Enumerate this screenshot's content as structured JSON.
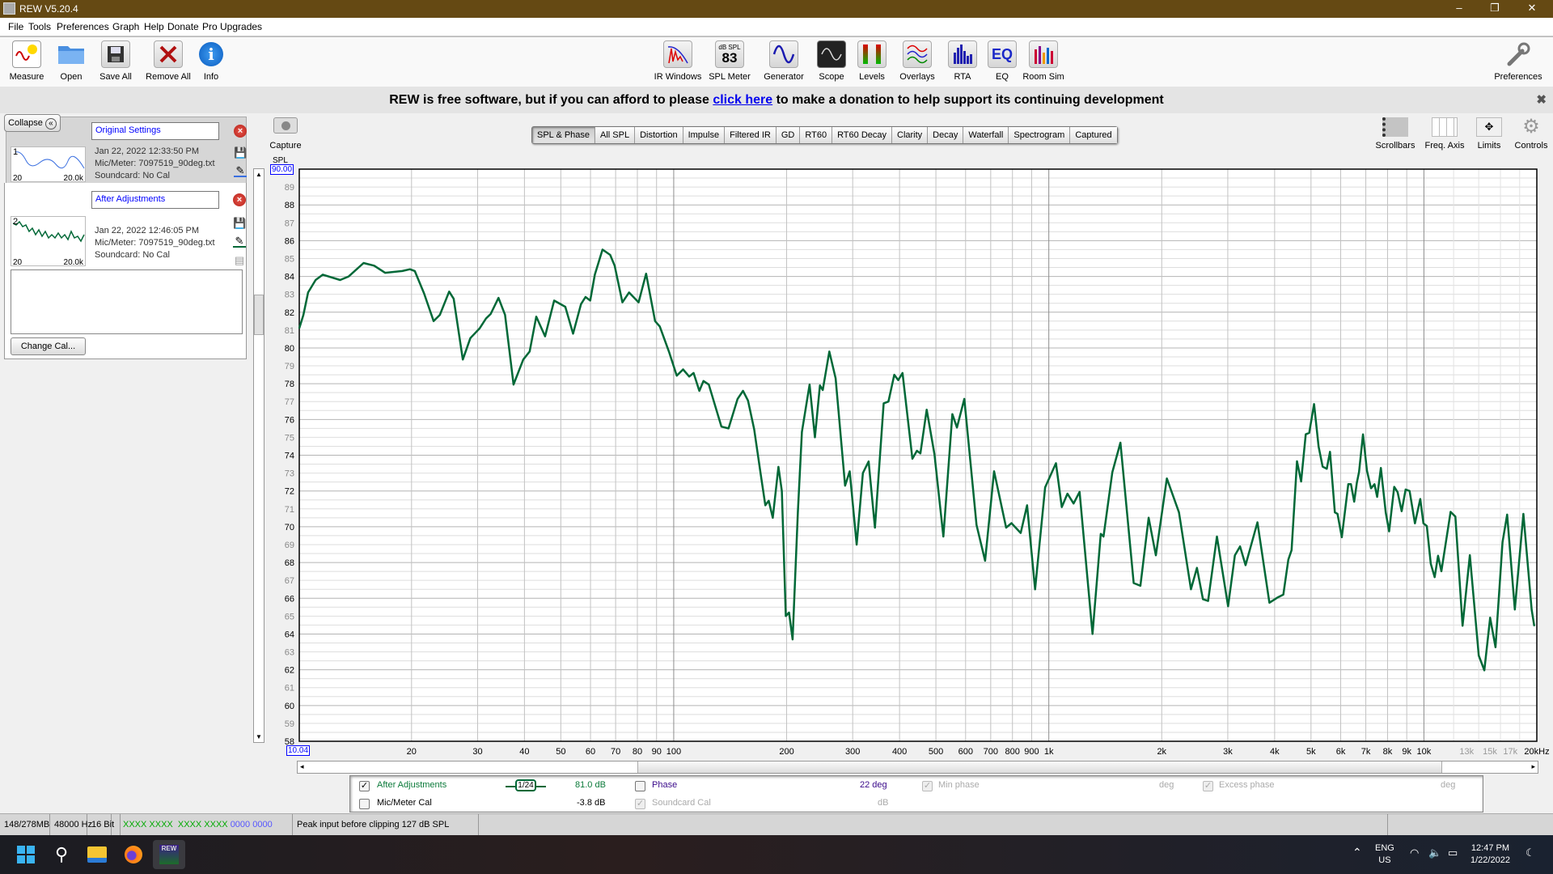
{
  "window": {
    "title": "REW V5.20.4",
    "minimize": "–",
    "restore": "❐",
    "close": "✕"
  },
  "menu": [
    "File",
    "Tools",
    "Preferences",
    "Graph",
    "Help",
    "Donate",
    "Pro Upgrades"
  ],
  "toolbar_left": [
    {
      "label": "Measure",
      "icon": "measure-icon"
    },
    {
      "label": "Open",
      "icon": "folder-icon"
    },
    {
      "label": "Save All",
      "icon": "save-all-icon"
    },
    {
      "label": "Remove All",
      "icon": "remove-all-icon"
    },
    {
      "label": "Info",
      "icon": "info-icon"
    }
  ],
  "toolbar_center": [
    {
      "label": "IR Windows",
      "icon": "ir-windows-icon"
    },
    {
      "label": "SPL Meter",
      "icon": "spl-meter-icon",
      "icon_text": "dB SPL",
      "icon_value": "83"
    },
    {
      "label": "Generator",
      "icon": "generator-icon"
    },
    {
      "label": "Scope",
      "icon": "scope-icon"
    },
    {
      "label": "Levels",
      "icon": "levels-icon"
    },
    {
      "label": "Overlays",
      "icon": "overlays-icon"
    },
    {
      "label": "RTA",
      "icon": "rta-icon"
    },
    {
      "label": "EQ",
      "icon": "eq-icon",
      "icon_text": "EQ"
    },
    {
      "label": "Room Sim",
      "icon": "room-sim-icon"
    }
  ],
  "toolbar_right": {
    "label": "Preferences",
    "icon": "wrench-icon"
  },
  "banner": {
    "before": "REW is free software, but if you can afford to please ",
    "link": "click here",
    "after": " to make a donation to help support its continuing development",
    "close": "✖"
  },
  "left_panel": {
    "collapse_label": "Collapse",
    "collapse_icon": "«",
    "measurements": [
      {
        "index": "1",
        "name": "Original Settings",
        "date": "Jan 22, 2022 12:33:50 PM",
        "mic": "Mic/Meter: 7097519_90deg.txt",
        "soundcard": "Soundcard: No Cal",
        "thumb_min": "20",
        "thumb_max": "20.0k",
        "color": "#3a6fe0"
      },
      {
        "index": "2",
        "name": "After Adjustments",
        "date": "Jan 22, 2022 12:46:05 PM",
        "mic": "Mic/Meter: 7097519_90deg.txt",
        "soundcard": "Soundcard: No Cal",
        "thumb_min": "20",
        "thumb_max": "20.0k",
        "color": "#006837"
      }
    ],
    "notes": "",
    "change_cal": "Change Cal..."
  },
  "graph_tabs": [
    "SPL & Phase",
    "All SPL",
    "Distortion",
    "Impulse",
    "Filtered IR",
    "GD",
    "RT60",
    "RT60 Decay",
    "Clarity",
    "Decay",
    "Waterfall",
    "Spectrogram",
    "Captured"
  ],
  "selected_tab": "SPL & Phase",
  "capture_label": "Capture",
  "graph_controls": [
    "Scrollbars",
    "Freq. Axis",
    "Limits",
    "Controls"
  ],
  "legend": {
    "trace_name": "After Adjustments",
    "trace_checked": true,
    "smoothing": "1/24",
    "trace_value": "81.0 dB",
    "phase_label": "Phase",
    "phase_value": "22 deg",
    "min_phase_label": "Min phase",
    "min_phase_unit": "deg",
    "excess_phase_label": "Excess phase",
    "excess_phase_unit": "deg",
    "mic_cal_label": "Mic/Meter Cal",
    "mic_cal_value": "-3.8 dB",
    "soundcard_cal_label": "Soundcard Cal",
    "soundcard_cal_unit": "dB",
    "colors": {
      "trace": "#006837",
      "phase": "#3a0a8a"
    }
  },
  "status_bar": {
    "memory": "148/278MB",
    "rate": "48000 Hz",
    "bits": "16 Bit",
    "levels_green": "XXXX XXXX  XXXX XXXX",
    "levels_blue": "0000 0000",
    "message": "Peak input before clipping 127 dB SPL"
  },
  "taskbar": {
    "lang1": "ENG",
    "lang2": "US",
    "time": "12:47 PM",
    "date": "1/22/2022",
    "rew_label": "REW"
  },
  "chart_data": {
    "type": "line",
    "x_scale": "log",
    "xlim": [
      10.04,
      20000
    ],
    "ylim": [
      58,
      90
    ],
    "ylabel": "SPL",
    "ymax_label": "90.00",
    "xmin_label": "10.04",
    "grid": true,
    "x_ticks": [
      {
        "f": 20,
        "label": "20"
      },
      {
        "f": 30,
        "label": "30"
      },
      {
        "f": 40,
        "label": "40"
      },
      {
        "f": 50,
        "label": "50"
      },
      {
        "f": 60,
        "label": "60"
      },
      {
        "f": 70,
        "label": "70"
      },
      {
        "f": 80,
        "label": "80"
      },
      {
        "f": 90,
        "label": "90"
      },
      {
        "f": 100,
        "label": "100"
      },
      {
        "f": 200,
        "label": "200"
      },
      {
        "f": 300,
        "label": "300"
      },
      {
        "f": 400,
        "label": "400"
      },
      {
        "f": 500,
        "label": "500"
      },
      {
        "f": 600,
        "label": "600"
      },
      {
        "f": 700,
        "label": "700"
      },
      {
        "f": 800,
        "label": "800"
      },
      {
        "f": 900,
        "label": "900"
      },
      {
        "f": 1000,
        "label": "1k"
      },
      {
        "f": 2000,
        "label": "2k"
      },
      {
        "f": 3000,
        "label": "3k"
      },
      {
        "f": 4000,
        "label": "4k"
      },
      {
        "f": 5000,
        "label": "5k"
      },
      {
        "f": 6000,
        "label": "6k"
      },
      {
        "f": 7000,
        "label": "7k"
      },
      {
        "f": 8000,
        "label": "8k"
      },
      {
        "f": 9000,
        "label": "9k"
      },
      {
        "f": 10000,
        "label": "10k"
      },
      {
        "f": 13000,
        "label": "13k",
        "dim": true
      },
      {
        "f": 15000,
        "label": "15k",
        "dim": true
      },
      {
        "f": 17000,
        "label": "17k",
        "dim": true
      },
      {
        "f": 20000,
        "label": "20kHz"
      }
    ],
    "series": [
      {
        "name": "After Adjustments",
        "color": "#006837",
        "freq": [
          10.04,
          10.3,
          10.6,
          11.1,
          11.6,
          12.9,
          13.6,
          14.9,
          15.9,
          17.0,
          18.9,
          19.8,
          20.4,
          21.6,
          22.9,
          23.8,
          25.2,
          25.9,
          27.4,
          28.7,
          30.4,
          31.6,
          32.5,
          34.1,
          35.5,
          37.4,
          39.7,
          41.3,
          43.0,
          45.4,
          48.0,
          51.4,
          53.9,
          56.6,
          58.2,
          59.9,
          61.6,
          64.6,
          67.7,
          69.6,
          73.0,
          76.0,
          80.6,
          84.4,
          89.2,
          91.8,
          97.1,
          101.9,
          105.9,
          110,
          113,
          117,
          120,
          124,
          134,
          140,
          148,
          153,
          157.8,
          163.9,
          170.7,
          175.5,
          179.2,
          183.7,
          190.2,
          194.2,
          199,
          203,
          207.5,
          214.3,
          219.7,
          230.2,
          237.9,
          245.4,
          249.7,
          259.9,
          270.2,
          286.4,
          294.5,
          307.4,
          319.4,
          330.8,
          343.9,
          362.9,
          373.6,
          387.3,
          396.8,
          407.3,
          432.9,
          445,
          454.5,
          472.5,
          495.6,
          523.5,
          553,
          569.1,
          595.4,
          641.5,
          676.3,
          714.6,
          769.7,
          795.1,
          841.5,
          875.2,
          919.4,
          977.4,
          1045,
          1083,
          1121,
          1164,
          1208,
          1308,
          1376,
          1399,
          1477,
          1552,
          1684,
          1755,
          1846,
          1929,
          2064,
          2224,
          2393,
          2482,
          2575,
          2659,
          2806,
          3006,
          3134,
          3235,
          3346,
          3599,
          3874,
          4081,
          4220,
          4351,
          4438,
          4589,
          4706,
          4840,
          4945,
          5095,
          5240,
          5370,
          5508,
          5618,
          5790,
          5884,
          6041,
          6285,
          6390,
          6518,
          6626,
          6715,
          6882,
          7050,
          7227,
          7383,
          7505,
          7680,
          7909,
          8078,
          8332,
          8511,
          8722,
          8938,
          9160,
          9464,
          9779,
          9970,
          10180,
          10430,
          10680,
          10910,
          11130,
          11780,
          12130,
          12680,
          13260,
          14000,
          14490,
          15020,
          15520,
          16200,
          16670,
          17470,
          18420,
          19370,
          19680
        ],
        "spl": [
          81.1,
          81.85,
          83.1,
          83.8,
          84.1,
          83.8,
          84.0,
          84.75,
          84.6,
          84.2,
          84.3,
          84.4,
          84.3,
          83.05,
          81.5,
          81.85,
          83.15,
          82.75,
          79.35,
          80.55,
          81.1,
          81.65,
          81.9,
          82.8,
          81.85,
          77.95,
          79.35,
          79.8,
          81.75,
          80.65,
          82.65,
          82.3,
          80.8,
          82.45,
          82.85,
          82.65,
          84.1,
          85.5,
          85.2,
          84.6,
          82.55,
          83.1,
          82.55,
          84.15,
          81.5,
          81.2,
          79.8,
          78.45,
          78.8,
          78.4,
          78.6,
          77.6,
          78.15,
          77.95,
          75.6,
          75.5,
          77.15,
          77.6,
          77.05,
          75.45,
          72.9,
          71.2,
          71.45,
          70.5,
          73.35,
          72.0,
          65.0,
          65.2,
          63.7,
          70.8,
          75.3,
          77.95,
          75.0,
          77.9,
          77.65,
          79.8,
          78.3,
          72.3,
          73.1,
          69.0,
          73.0,
          73.65,
          69.95,
          76.9,
          77.0,
          78.5,
          78.2,
          78.6,
          73.8,
          74.25,
          74.1,
          76.55,
          74.05,
          69.45,
          76.3,
          75.55,
          77.15,
          70.1,
          68.1,
          73.1,
          69.95,
          70.2,
          69.65,
          71.2,
          66.5,
          72.2,
          73.55,
          71.1,
          71.85,
          71.3,
          71.95,
          64.0,
          69.6,
          69.45,
          73.05,
          74.7,
          66.85,
          66.7,
          70.5,
          68.4,
          72.7,
          70.8,
          66.5,
          67.7,
          65.95,
          65.85,
          69.45,
          65.55,
          68.4,
          68.9,
          67.85,
          70.25,
          65.75,
          66.05,
          66.2,
          68.16,
          68.69,
          73.66,
          72.53,
          75.17,
          75.25,
          76.86,
          74.49,
          73.36,
          73.24,
          74.19,
          70.8,
          70.72,
          69.41,
          72.38,
          72.38,
          71.4,
          72.46,
          73.06,
          75.17,
          73.13,
          72.15,
          72.38,
          71.67,
          73.29,
          70.8,
          69.74,
          72.23,
          71.93,
          70.87,
          72.08,
          72.0,
          70.19,
          71.55,
          70.19,
          70.04,
          67.93,
          67.18,
          68.38,
          67.51,
          70.83,
          70.57,
          64.46,
          68.41,
          62.8,
          61.97,
          64.91,
          63.26,
          69.14,
          70.68,
          65.37,
          70.72,
          65.37,
          64.46
        ]
      }
    ]
  }
}
